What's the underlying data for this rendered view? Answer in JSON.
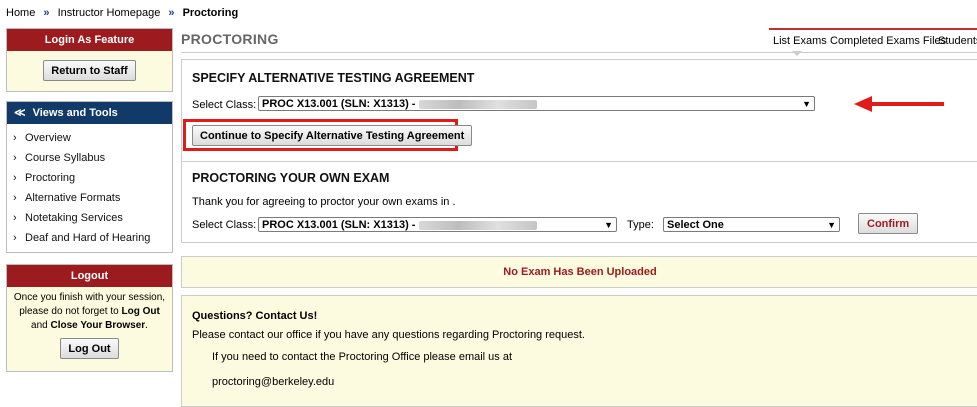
{
  "breadcrumb": {
    "home": "Home",
    "instructor": "Instructor Homepage",
    "current": "Proctoring",
    "sep": "»"
  },
  "sidebar": {
    "login_as": {
      "title": "Login As Feature",
      "button": "Return to Staff"
    },
    "views": {
      "title": "Views and Tools",
      "icon": "double-chevron-down-icon",
      "items": [
        {
          "label": "Overview"
        },
        {
          "label": "Course Syllabus"
        },
        {
          "label": "Proctoring"
        },
        {
          "label": "Alternative Formats"
        },
        {
          "label": "Notetaking Services"
        },
        {
          "label": "Deaf and Hard of Hearing"
        }
      ]
    },
    "logout": {
      "title": "Logout",
      "line1": "Once you finish with your session,",
      "line2_pre": "please do not forget to ",
      "line2_bold": "Log Out",
      "line3_pre": "and ",
      "line3_bold": "Close Your Browser",
      "line3_post": ".",
      "button": "Log Out"
    }
  },
  "header": {
    "title": "PROCTORING",
    "tabs": [
      {
        "label": "List Exams"
      },
      {
        "label": "Completed Exams Files"
      },
      {
        "label": "Students"
      }
    ]
  },
  "alt_agreement": {
    "title": "SPECIFY ALTERNATIVE TESTING AGREEMENT",
    "select_label": "Select Class:",
    "select_value": "PROC X13.001 (SLN: X1313) -",
    "button": "Continue to Specify Alternative Testing Agreement",
    "highlight_color": "#e01b1b"
  },
  "own_exam": {
    "title": "PROCTORING YOUR OWN EXAM",
    "thanks": "Thank you for agreeing to proctor your own exams in .",
    "select_label": "Select Class:",
    "select_value": "PROC X13.001 (SLN: X1313) -",
    "type_label": "Type:",
    "type_value": "Select One",
    "confirm": "Confirm"
  },
  "no_exam": {
    "message": "No Exam Has Been Uploaded"
  },
  "contact": {
    "title": "Questions? Contact Us!",
    "line1": "Please contact our office if you have any questions regarding Proctoring request.",
    "line2": "If you need to contact the Proctoring Office please email us at",
    "email": "proctoring@berkeley.edu"
  },
  "colors": {
    "brand_red": "#9b1b1f",
    "nav_blue": "#123a68",
    "panel_yellow": "#fcfadf",
    "confirm_red": "#9b1b1f"
  }
}
